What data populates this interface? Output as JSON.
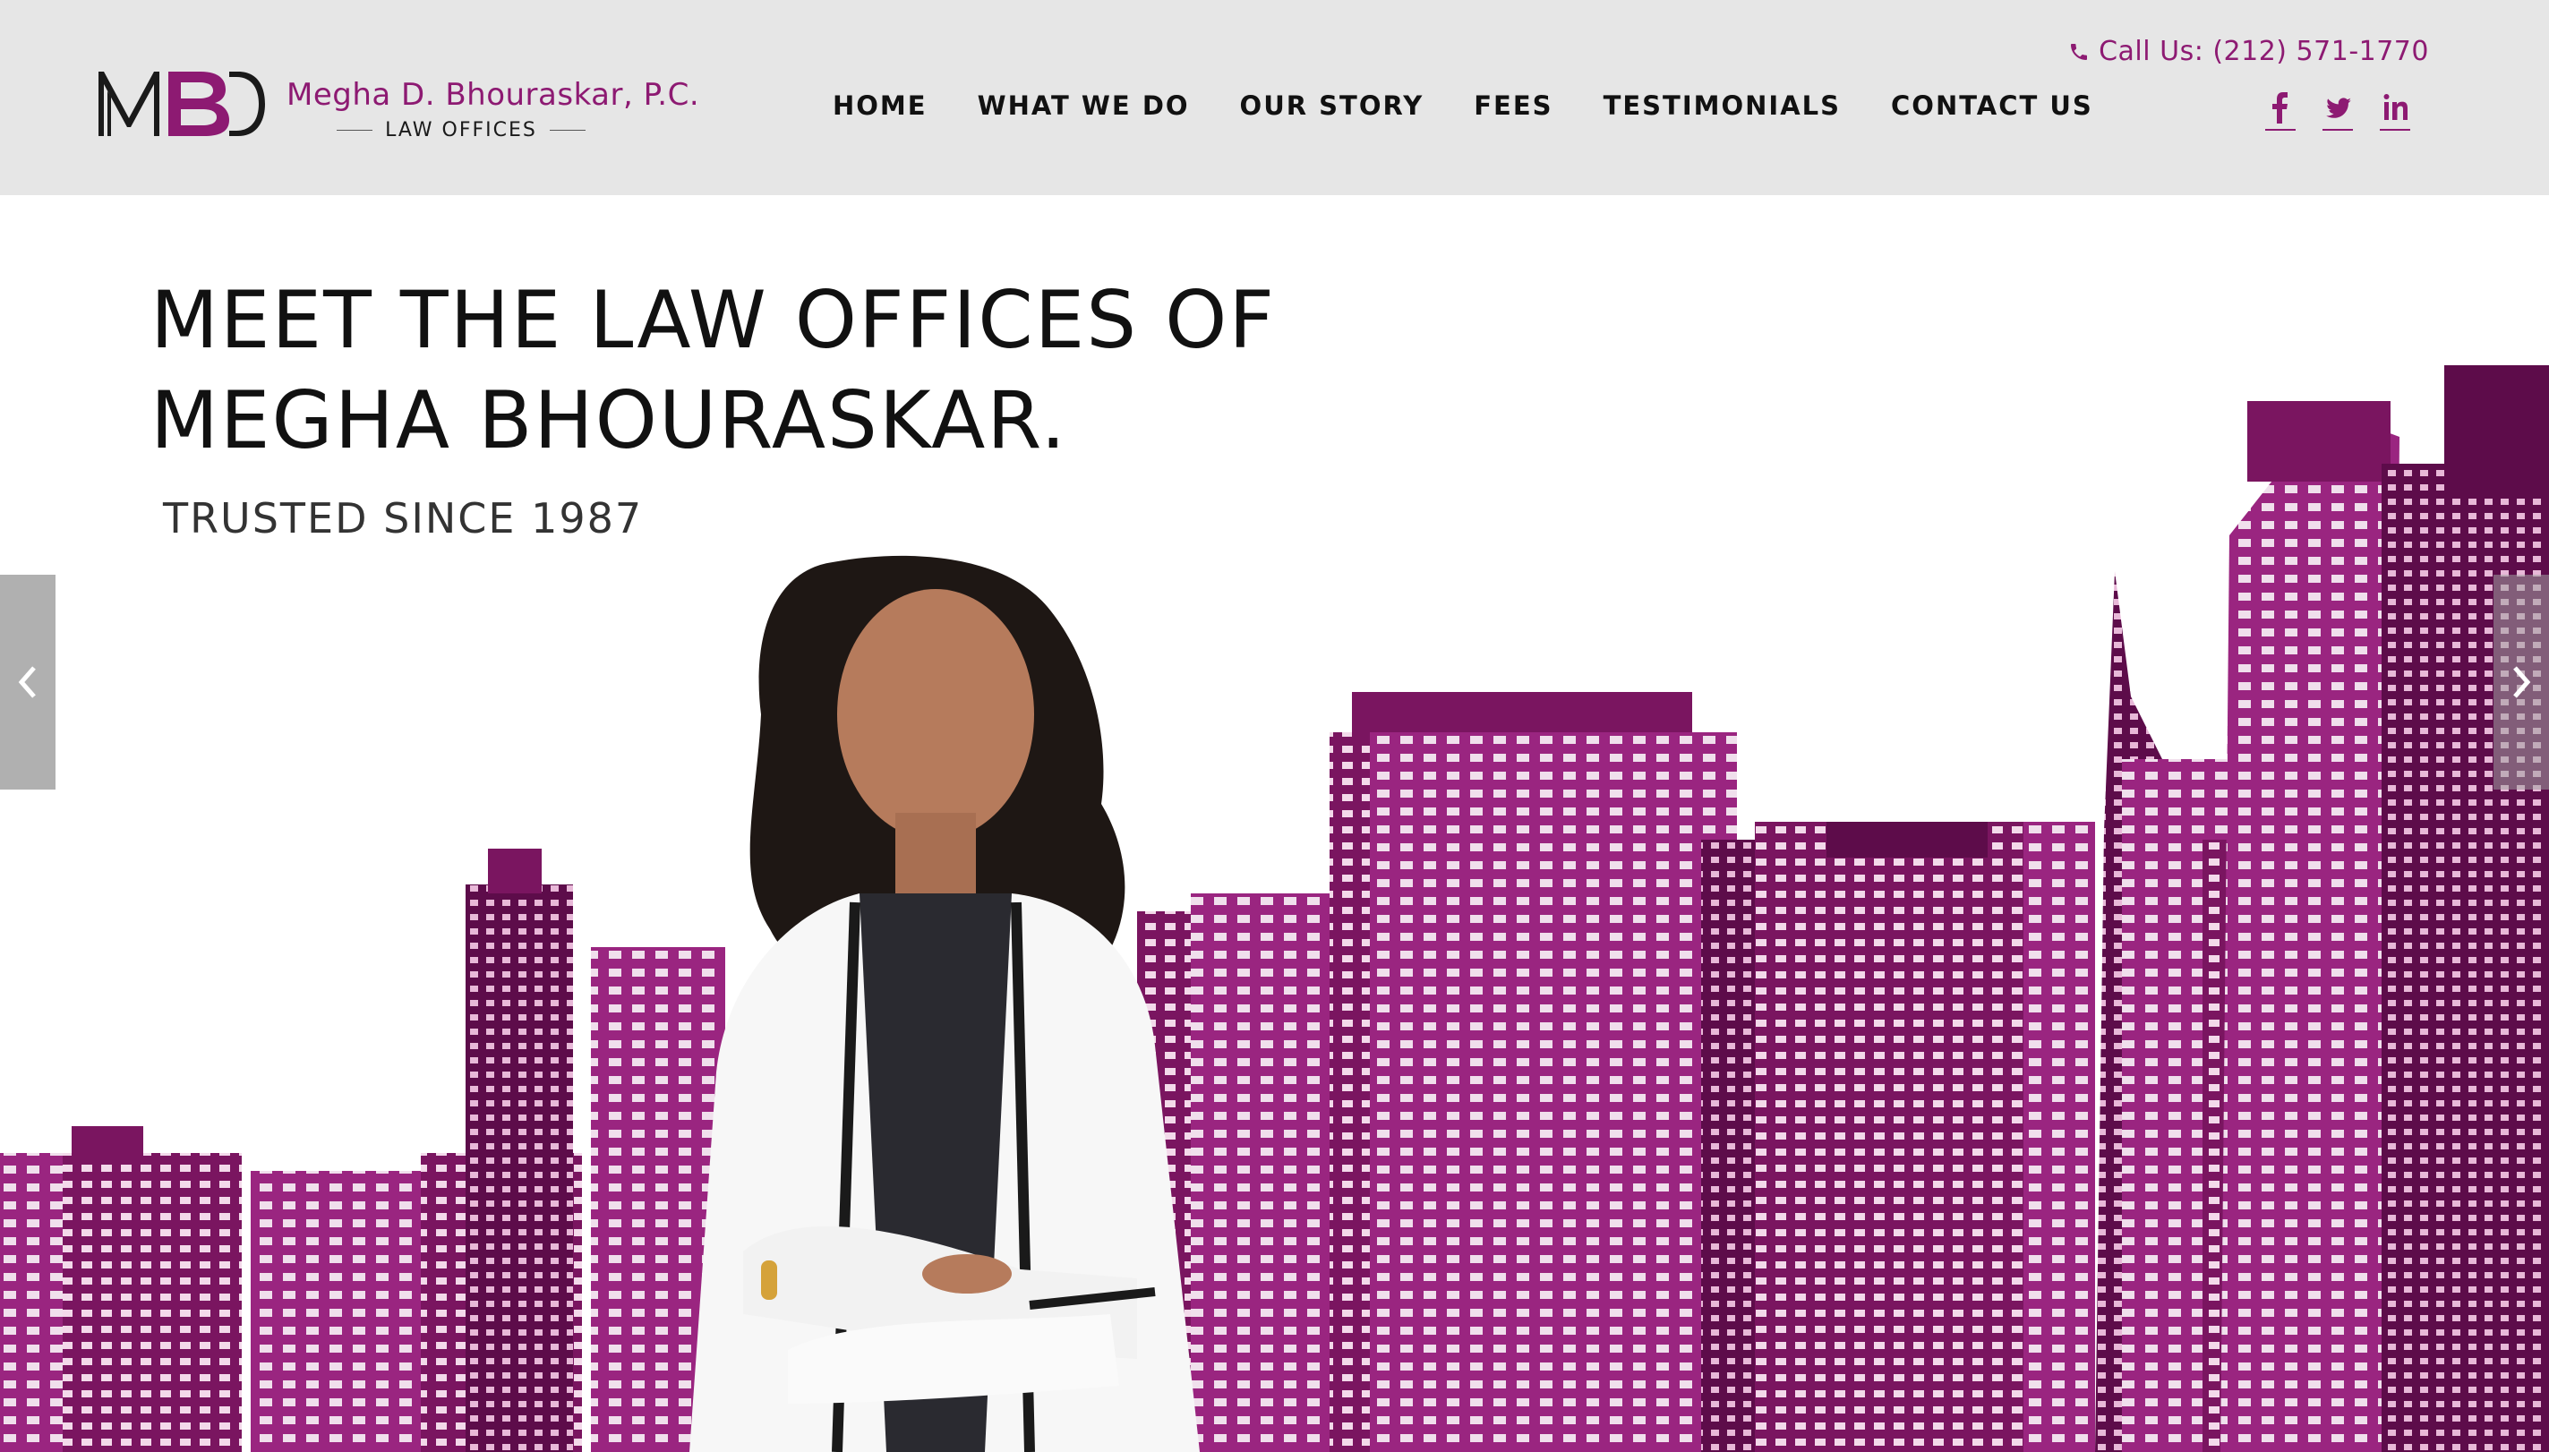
{
  "brand": {
    "monogram": "MBD",
    "name": "Megha D. Bhouraskar, P.C.",
    "subtitle": "LAW OFFICES",
    "accent_color": "#8d1a72"
  },
  "nav": {
    "items": [
      {
        "label": "HOME"
      },
      {
        "label": "WHAT WE DO"
      },
      {
        "label": "OUR STORY"
      },
      {
        "label": "FEES"
      },
      {
        "label": "TESTIMONIALS"
      },
      {
        "label": "CONTACT US"
      }
    ]
  },
  "contact": {
    "call_text": "Call Us: (212) 571-1770",
    "icon": "phone-icon"
  },
  "social": [
    {
      "icon": "facebook-icon"
    },
    {
      "icon": "twitter-icon"
    },
    {
      "icon": "linkedin-icon"
    }
  ],
  "hero": {
    "title_line1": "MEET THE LAW OFFICES OF",
    "title_line2": "MEGHA BHOURASKAR.",
    "subtitle": "TRUSTED SINCE 1987",
    "prev_icon": "chevron-left-icon",
    "next_icon": "chevron-right-icon",
    "skyline_color": "#8a1a6e"
  }
}
